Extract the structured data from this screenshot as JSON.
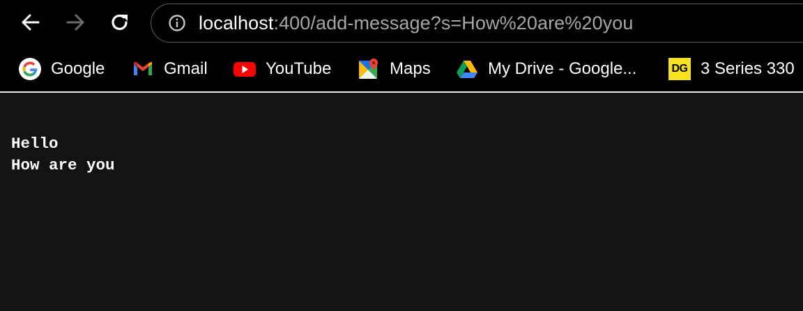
{
  "browser": {
    "address_bar": {
      "host": "localhost",
      "rest": ":400/add-message?s=How%20are%20you"
    },
    "buttons": {
      "back": "back-arrow-icon",
      "forward": "forward-arrow-icon",
      "reload": "reload-icon",
      "site_info": "info-icon"
    },
    "bookmarks": [
      {
        "label": "Google",
        "icon": "google-icon"
      },
      {
        "label": "Gmail",
        "icon": "gmail-icon"
      },
      {
        "label": "YouTube",
        "icon": "youtube-icon"
      },
      {
        "label": "Maps",
        "icon": "maps-icon"
      },
      {
        "label": "My Drive - Google...",
        "icon": "google-drive-icon"
      },
      {
        "label": "3 Series 330",
        "icon": "dg-icon",
        "badge": "DG"
      }
    ],
    "colors": {
      "toolbar_bg": "#000000",
      "page_bg": "#131313",
      "url_host": "#ffffff",
      "url_rest": "#a6a6a6"
    }
  },
  "page": {
    "messages": [
      "Hello",
      "How are you"
    ]
  }
}
